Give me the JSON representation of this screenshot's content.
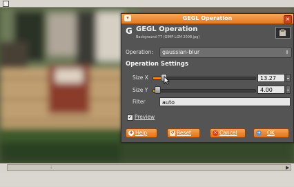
{
  "dialog": {
    "window_title": "GEGL Operation",
    "header_title": "GEGL Operation",
    "header_subtitle": "Background-77 (GIMP LGM 2008.jpg)",
    "operation_label": "Operation:",
    "operation_value": "gaussian-blur",
    "section_title": "Operation Settings",
    "size_x": {
      "label": "Size X",
      "value": "13.27",
      "fraction": 0.09
    },
    "size_y": {
      "label": "Size Y",
      "value": "4.00",
      "fraction": 0.03
    },
    "filter": {
      "label": "Filter",
      "value": "auto"
    },
    "preview": {
      "label": "Preview",
      "checked": true
    },
    "buttons": {
      "help": "Help",
      "reset": "Reset",
      "cancel": "Cancel",
      "ok": "OK"
    }
  },
  "colors": {
    "accent": "#e8891a",
    "dialog_bg": "#545454"
  },
  "icons": [
    "gimp-g-icon",
    "help-icon",
    "reset-icon",
    "cancel-icon",
    "ok-icon",
    "close-icon",
    "combo-arrow-icon"
  ]
}
